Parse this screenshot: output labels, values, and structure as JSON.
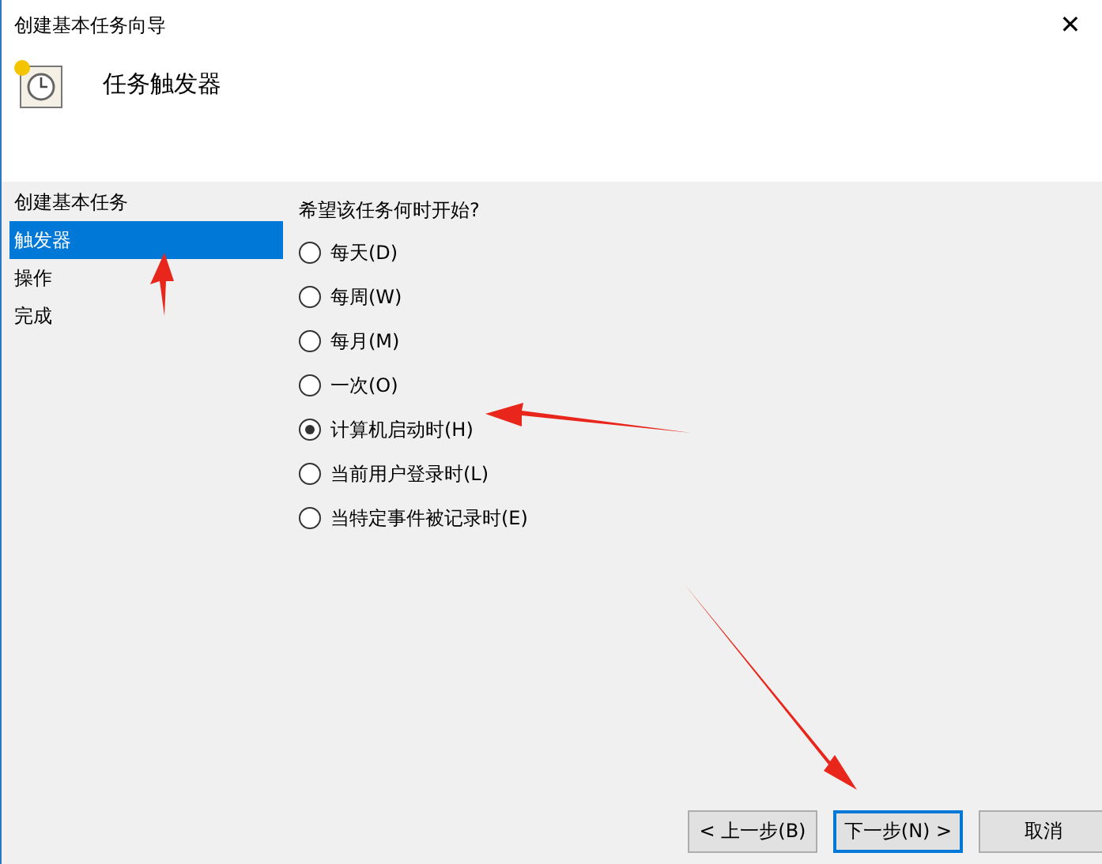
{
  "window": {
    "title": "创建基本任务向导",
    "close": "✕"
  },
  "header": {
    "title": "任务触发器"
  },
  "sidebar": {
    "items": [
      {
        "label": "创建基本任务",
        "selected": false
      },
      {
        "label": "触发器",
        "selected": true
      },
      {
        "label": "操作",
        "selected": false
      },
      {
        "label": "完成",
        "selected": false
      }
    ]
  },
  "question": "希望该任务何时开始?",
  "options": [
    {
      "label": "每天(D)",
      "selected": false
    },
    {
      "label": "每周(W)",
      "selected": false
    },
    {
      "label": "每月(M)",
      "selected": false
    },
    {
      "label": "一次(O)",
      "selected": false
    },
    {
      "label": "计算机启动时(H)",
      "selected": true
    },
    {
      "label": "当前用户登录时(L)",
      "selected": false
    },
    {
      "label": "当特定事件被记录时(E)",
      "selected": false
    }
  ],
  "buttons": [
    {
      "label": "< 上一步(B)",
      "default": false
    },
    {
      "label": "下一步(N) >",
      "default": true
    },
    {
      "label": "取消",
      "default": false
    }
  ]
}
